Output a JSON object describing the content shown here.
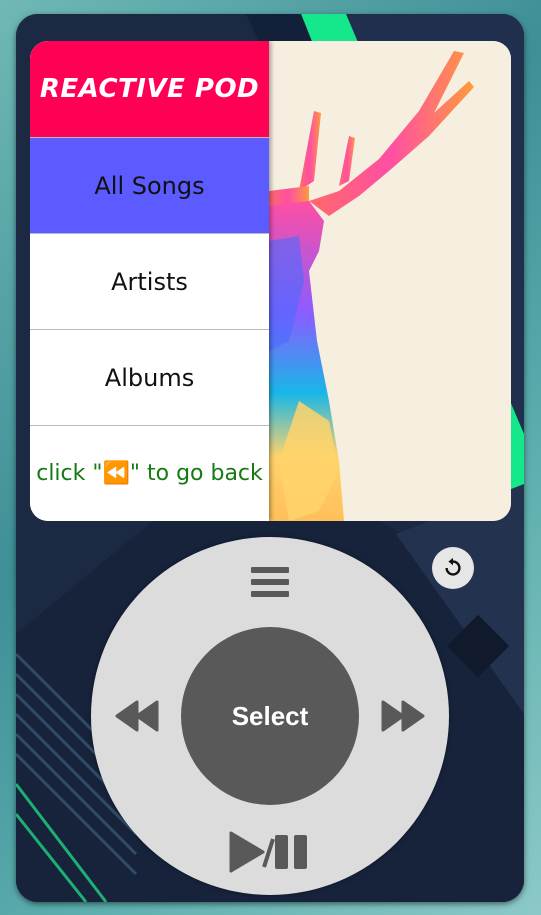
{
  "app": {
    "title": "REACTIVE POD"
  },
  "menu": {
    "items": [
      {
        "label": "All Songs",
        "active": true
      },
      {
        "label": "Artists",
        "active": false
      },
      {
        "label": "Albums",
        "active": false
      }
    ],
    "hint": "click \"⏪\" to go back"
  },
  "controls": {
    "select_label": "Select",
    "menu_icon": "menu-icon",
    "prev_icon": "rewind-icon",
    "next_icon": "fast-forward-icon",
    "play_pause_icon": "play-pause-icon",
    "reset_icon": "reset-icon"
  },
  "colors": {
    "title_bg": "#ff0055",
    "active_item_bg": "#5b5bff",
    "hint_text": "#157a12",
    "wheel": "#dcdcdc",
    "select_button": "#595959",
    "icon": "#595959"
  }
}
